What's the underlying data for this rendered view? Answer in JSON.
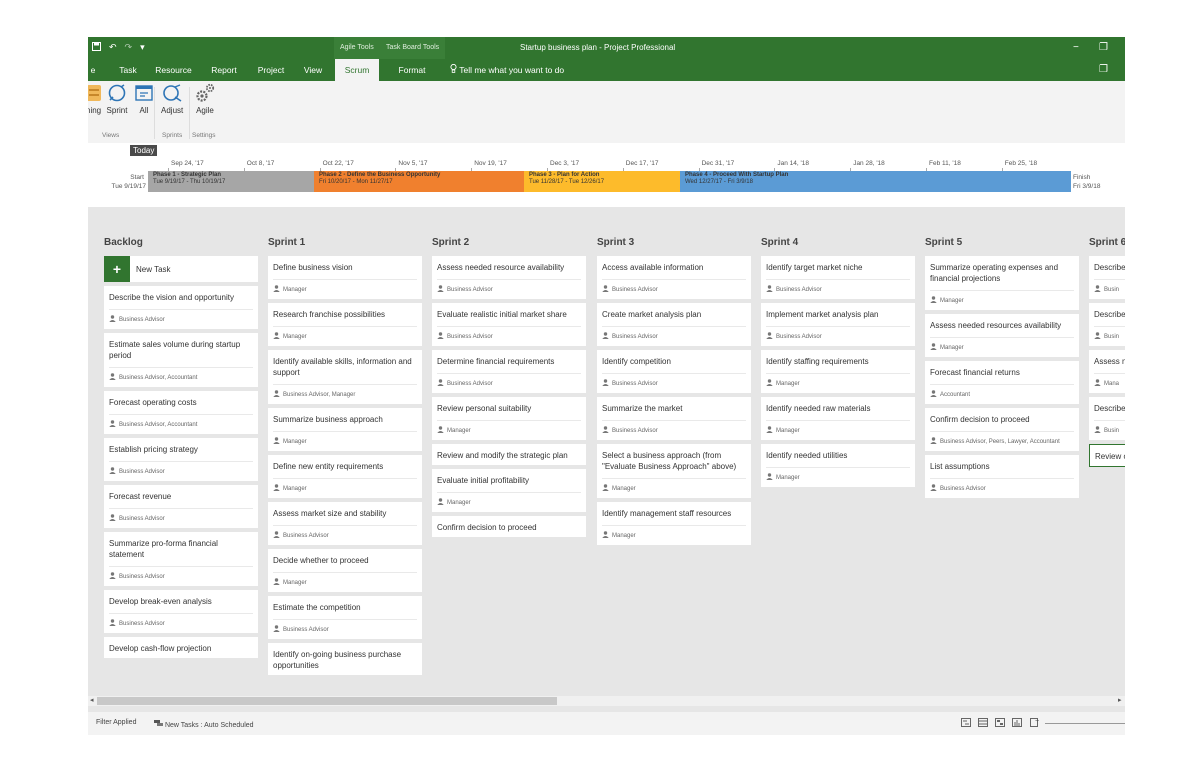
{
  "titlebar": {
    "qat_icons": [
      "save-icon",
      "undo-icon",
      "redo-icon"
    ],
    "undo_glyph": "↶",
    "redo_glyph": "↷",
    "more_glyph": "▾",
    "context_tabs": [
      "Agile Tools",
      "Task Board Tools"
    ],
    "title": "Startup business plan  -  Project Professional",
    "minimize": "−",
    "restore": "❐"
  },
  "tabs": {
    "items": [
      "e",
      "Task",
      "Resource",
      "Report",
      "Project",
      "View",
      "Scrum",
      "Format"
    ],
    "active": "Scrum",
    "tell_me": "Tell me what you want to do",
    "ribbon_restore": "❐"
  },
  "ribbon": {
    "buttons": [
      "ning",
      "Sprint",
      "All",
      "Adjust",
      "Agile"
    ],
    "groups": [
      "Views",
      "Sprints",
      "Settings"
    ]
  },
  "timeline": {
    "today": "Today",
    "start_label": "Start",
    "start_date": "Tue 9/19/17",
    "finish_label": "Finish",
    "finish_date": "Fri 3/9/18",
    "ticks": [
      "Sep 24, '17",
      "Oct 8, '17",
      "Oct 22, '17",
      "Nov 5, '17",
      "Nov 19, '17",
      "Dec 3, '17",
      "Dec 17, '17",
      "Dec 31, '17",
      "Jan 14, '18",
      "Jan 28, '18",
      "Feb 11, '18",
      "Feb 25, '18"
    ],
    "phases": [
      {
        "name": "Phase 1 - Strategic Plan",
        "dates": "Tue 9/19/17 - Thu 10/19/17",
        "color": "#a6a6a6"
      },
      {
        "name": "Phase 2 - Define the Business Opportunity",
        "dates": "Fri 10/20/17 - Mon 11/27/17",
        "color": "#f0802e"
      },
      {
        "name": "Phase 3 - Plan for Action",
        "dates": "Tue 11/28/17 - Tue 12/26/17",
        "color": "#fdbb2b"
      },
      {
        "name": "Phase 4 - Proceed With Startup Plan",
        "dates": "Wed 12/27/17 - Fri 3/9/18",
        "color": "#5b9bd5"
      }
    ]
  },
  "board": {
    "new_task_label": "New Task",
    "columns": [
      {
        "title": "Backlog",
        "cards": [
          {
            "title": "Describe the vision and opportunity",
            "assignee": "Business Advisor"
          },
          {
            "title": "Estimate sales volume during startup period",
            "assignee": "Business Advisor, Accountant"
          },
          {
            "title": "Forecast operating costs",
            "assignee": "Business Advisor, Accountant"
          },
          {
            "title": "Establish pricing strategy",
            "assignee": "Business Advisor"
          },
          {
            "title": "Forecast revenue",
            "assignee": "Business Advisor"
          },
          {
            "title": "Summarize pro-forma financial statement",
            "assignee": "Business Advisor"
          },
          {
            "title": "Develop break-even analysis",
            "assignee": "Business Advisor"
          },
          {
            "title": "Develop cash-flow projection",
            "assignee": ""
          }
        ]
      },
      {
        "title": "Sprint 1",
        "cards": [
          {
            "title": "Define business vision",
            "assignee": "Manager"
          },
          {
            "title": "Research franchise possibilities",
            "assignee": "Manager"
          },
          {
            "title": "Identify available skills, information and support",
            "assignee": "Business Advisor, Manager"
          },
          {
            "title": "Summarize business approach",
            "assignee": "Manager"
          },
          {
            "title": "Define new entity requirements",
            "assignee": "Manager"
          },
          {
            "title": "Assess market size and stability",
            "assignee": "Business Advisor"
          },
          {
            "title": "Decide whether to proceed",
            "assignee": "Manager"
          },
          {
            "title": "Estimate the competition",
            "assignee": "Business Advisor"
          },
          {
            "title": "Identify on-going business purchase opportunities",
            "assignee": ""
          }
        ]
      },
      {
        "title": "Sprint 2",
        "cards": [
          {
            "title": "Assess needed resource availability",
            "assignee": "Business Advisor"
          },
          {
            "title": "Evaluate realistic initial market share",
            "assignee": "Business Advisor"
          },
          {
            "title": "Determine financial requirements",
            "assignee": "Business Advisor"
          },
          {
            "title": "Review personal suitability",
            "assignee": "Manager"
          },
          {
            "title": "Review and modify the strategic plan",
            "assignee": ""
          },
          {
            "title": "Evaluate initial profitability",
            "assignee": "Manager"
          },
          {
            "title": "Confirm decision to proceed",
            "assignee": ""
          }
        ]
      },
      {
        "title": "Sprint 3",
        "cards": [
          {
            "title": "Access available information",
            "assignee": "Business Advisor"
          },
          {
            "title": "Create market analysis plan",
            "assignee": "Business Advisor"
          },
          {
            "title": "Identify competition",
            "assignee": "Business Advisor"
          },
          {
            "title": "Summarize the market",
            "assignee": "Business Advisor"
          },
          {
            "title": "Select a business approach (from \"Evaluate Business Approach\" above)",
            "assignee": "Manager"
          },
          {
            "title": "Identify management staff resources",
            "assignee": "Manager"
          }
        ]
      },
      {
        "title": "Sprint 4",
        "cards": [
          {
            "title": "Identify target market niche",
            "assignee": "Business Advisor"
          },
          {
            "title": "Implement market analysis plan",
            "assignee": "Business Advisor"
          },
          {
            "title": "Identify staffing requirements",
            "assignee": "Manager"
          },
          {
            "title": "Identify needed raw materials",
            "assignee": "Manager"
          },
          {
            "title": "Identify needed utilities",
            "assignee": "Manager"
          }
        ]
      },
      {
        "title": "Sprint 5",
        "cards": [
          {
            "title": "Summarize operating expenses and financial projections",
            "assignee": "Manager"
          },
          {
            "title": "Assess needed resources availability",
            "assignee": "Manager"
          },
          {
            "title": "Forecast financial returns",
            "assignee": "Accountant"
          },
          {
            "title": "Confirm decision to proceed",
            "assignee": "Business Advisor, Peers, Lawyer, Accountant"
          },
          {
            "title": "List assumptions",
            "assignee": "Business Advisor"
          }
        ]
      },
      {
        "title": "Sprint 6",
        "cards": [
          {
            "title": "Describe",
            "assignee": "Busin"
          },
          {
            "title": "Describe",
            "assignee": "Busin"
          },
          {
            "title": "Assess n",
            "assignee": "Mana"
          },
          {
            "title": "Describe assets a",
            "assignee": "Busin"
          },
          {
            "title": "Review opportu",
            "assignee": "",
            "selected": true
          }
        ]
      }
    ]
  },
  "scrollbar": {
    "left_arrow": "◂",
    "right_arrow": "▸"
  },
  "status": {
    "left_item": "Filter Applied",
    "new_tasks": "New Tasks : Auto Scheduled",
    "view_icons": [
      "gantt-view-icon",
      "task-usage-icon",
      "team-planner-icon",
      "report-view-icon",
      "normal-view-icon"
    ],
    "zoom_minus": "−"
  },
  "colors": {
    "brand_green": "#31752f",
    "board_bg": "#e6e6e6",
    "card_bg": "#ffffff"
  }
}
